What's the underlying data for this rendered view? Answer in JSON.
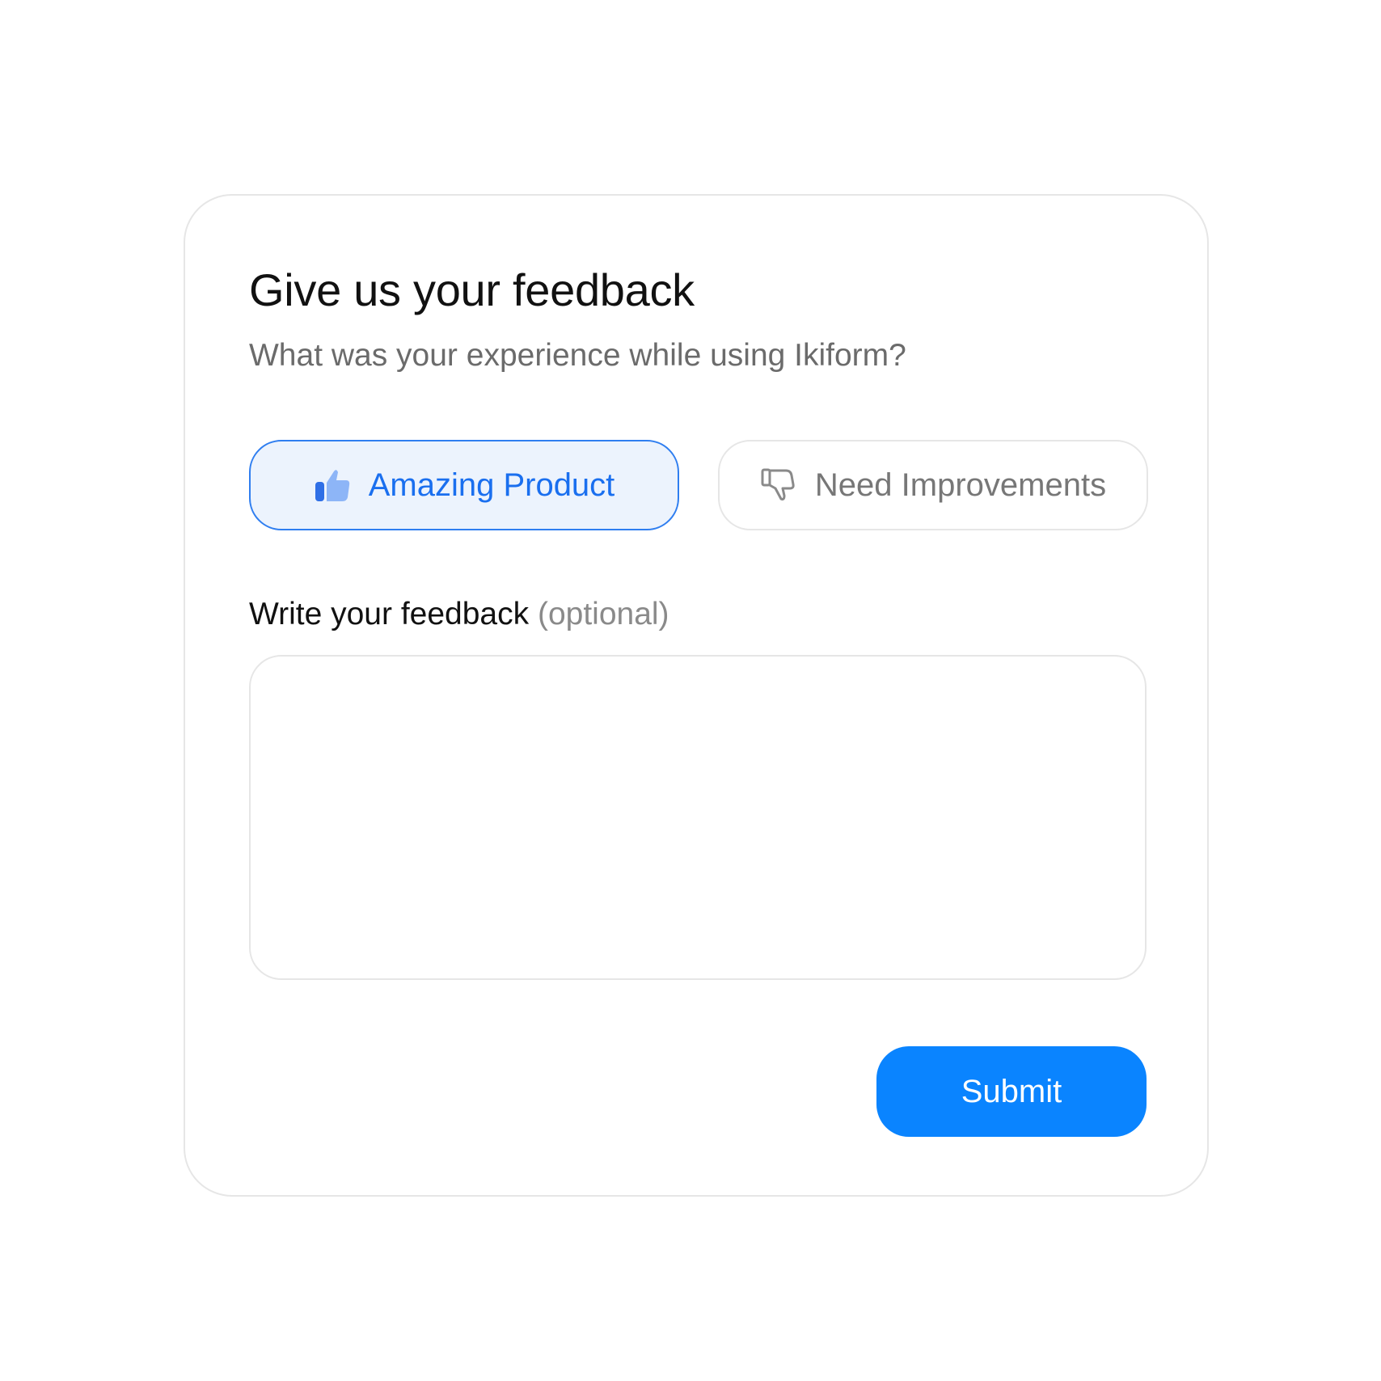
{
  "form": {
    "title": "Give us your feedback",
    "subtitle": "What was your experience while using Ikiform?",
    "choices": [
      {
        "label": "Amazing Product",
        "icon": "thumbs-up-icon",
        "selected": true
      },
      {
        "label": "Need Improvements",
        "icon": "thumbs-down-icon",
        "selected": false
      }
    ],
    "feedback_label": "Write your feedback",
    "feedback_optional": "(optional)",
    "feedback_value": "",
    "submit_label": "Submit"
  },
  "colors": {
    "accent": "#0a84ff",
    "selected_border": "#2f7ef0",
    "selected_background": "#ecf3fd",
    "selected_text": "#1a6fef",
    "muted_text": "#6b6b6b",
    "border": "#e6e6e6"
  }
}
